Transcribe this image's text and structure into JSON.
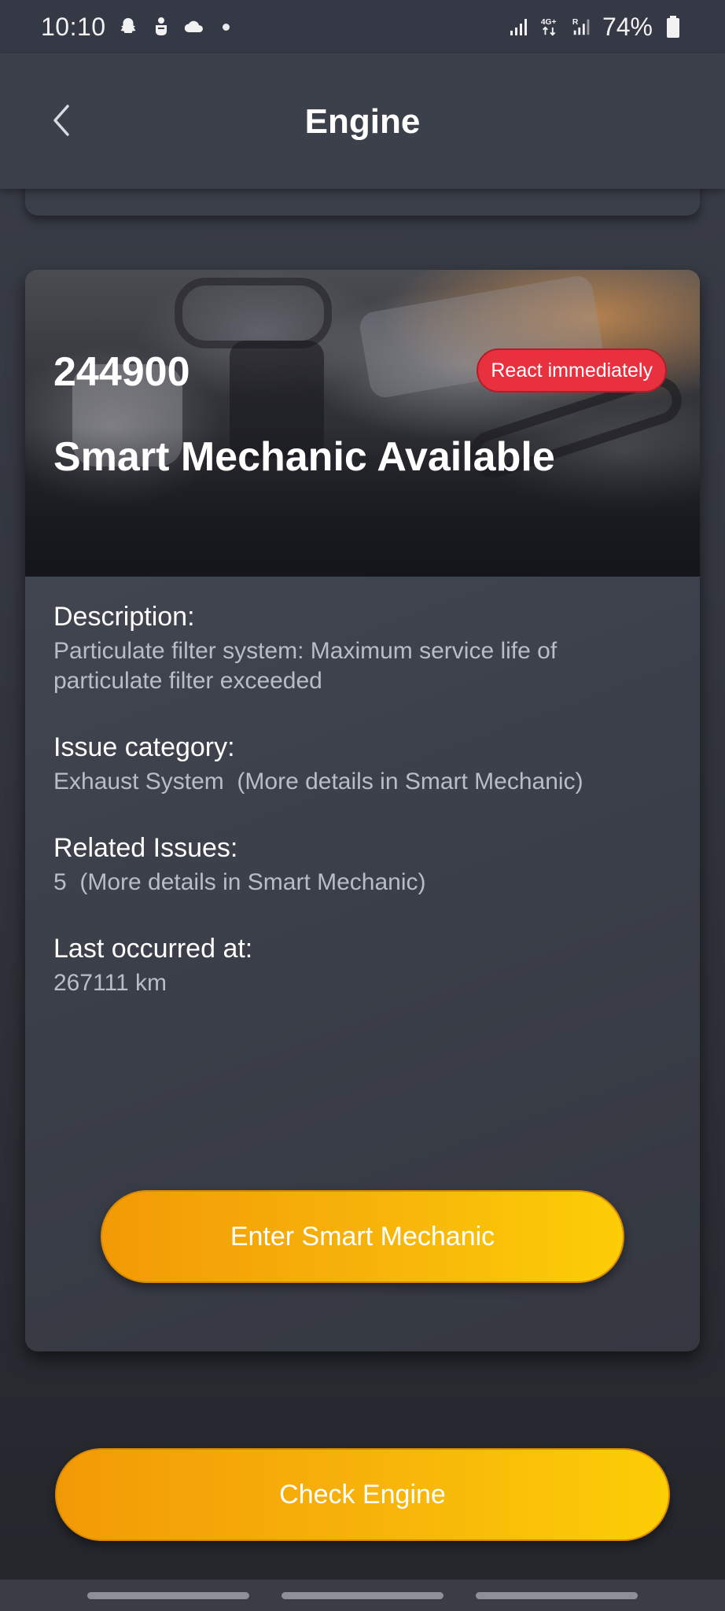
{
  "status_bar": {
    "time": "10:10",
    "battery_percent": "74%",
    "network_type": "4G+",
    "icons": [
      "snapchat-icon",
      "teams-icon",
      "cloud-icon",
      "notification-dot",
      "signal-icon",
      "signal-4g-icon",
      "signal-r-icon",
      "battery-icon"
    ]
  },
  "header": {
    "title": "Engine",
    "back_icon": "chevron-left-icon"
  },
  "card": {
    "code": "244900",
    "badge": "React immediately",
    "title": "Smart Mechanic Available",
    "fields": [
      {
        "label": "Description:",
        "value": "Particulate filter system: Maximum service life of particulate filter exceeded"
      },
      {
        "label": "Issue category:",
        "value": "Exhaust System  (More details in Smart Mechanic)"
      },
      {
        "label": "Related Issues:",
        "value": "5  (More details in Smart Mechanic)"
      },
      {
        "label": "Last occurred at:",
        "value": "267111 km"
      }
    ],
    "button_label": "Enter Smart Mechanic"
  },
  "footer": {
    "button_label": "Check Engine"
  },
  "colors": {
    "badge_red": "#e8303f",
    "button_orange": "#f29a06",
    "button_yellow": "#fcce06"
  }
}
